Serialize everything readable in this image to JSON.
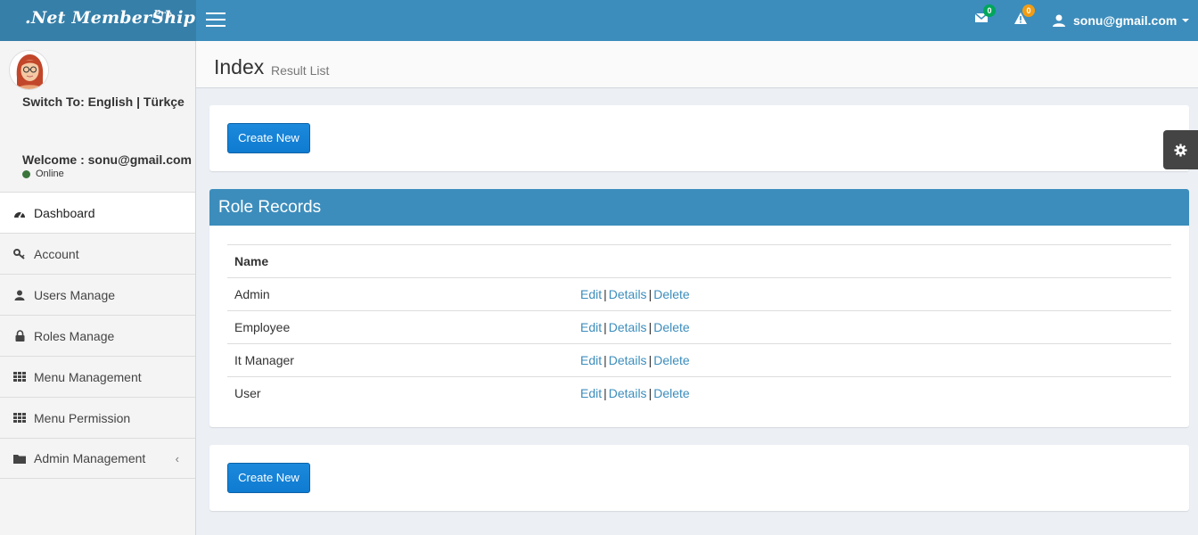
{
  "header": {
    "logo_text": ".Net MemberShip",
    "logo_sup": "Pro",
    "messages_count": "0",
    "alerts_count": "0",
    "user_email": "sonu@gmail.com"
  },
  "sidebar": {
    "switch_to_label": "Switch To:",
    "lang_english": "English",
    "lang_separator": "|",
    "lang_turkish": "Türkçe",
    "welcome": "Welcome : sonu@gmail.com",
    "status": "Online",
    "items": [
      {
        "label": "Dashboard",
        "icon": "dashboard-icon"
      },
      {
        "label": "Account",
        "icon": "key-icon"
      },
      {
        "label": "Users Manage",
        "icon": "user-icon"
      },
      {
        "label": "Roles Manage",
        "icon": "lock-icon"
      },
      {
        "label": "Menu Management",
        "icon": "grid-icon"
      },
      {
        "label": "Menu Permission",
        "icon": "grid-icon"
      },
      {
        "label": "Admin Management",
        "icon": "folder-icon",
        "chevron": "‹"
      }
    ]
  },
  "content": {
    "title": "Index",
    "subtitle": "Result List",
    "create_new_label": "Create New",
    "box_title": "Role Records",
    "table": {
      "header": "Name",
      "rows": [
        {
          "name": "Admin"
        },
        {
          "name": "Employee"
        },
        {
          "name": "It Manager"
        },
        {
          "name": "User"
        }
      ],
      "action_edit": "Edit",
      "action_details": "Details",
      "action_delete": "Delete",
      "action_separator": "|"
    }
  },
  "colors": {
    "header": "#3c8dbc",
    "logo_bg": "#367fa9",
    "button": "#0f7bd1",
    "link": "#3c8dbc"
  }
}
